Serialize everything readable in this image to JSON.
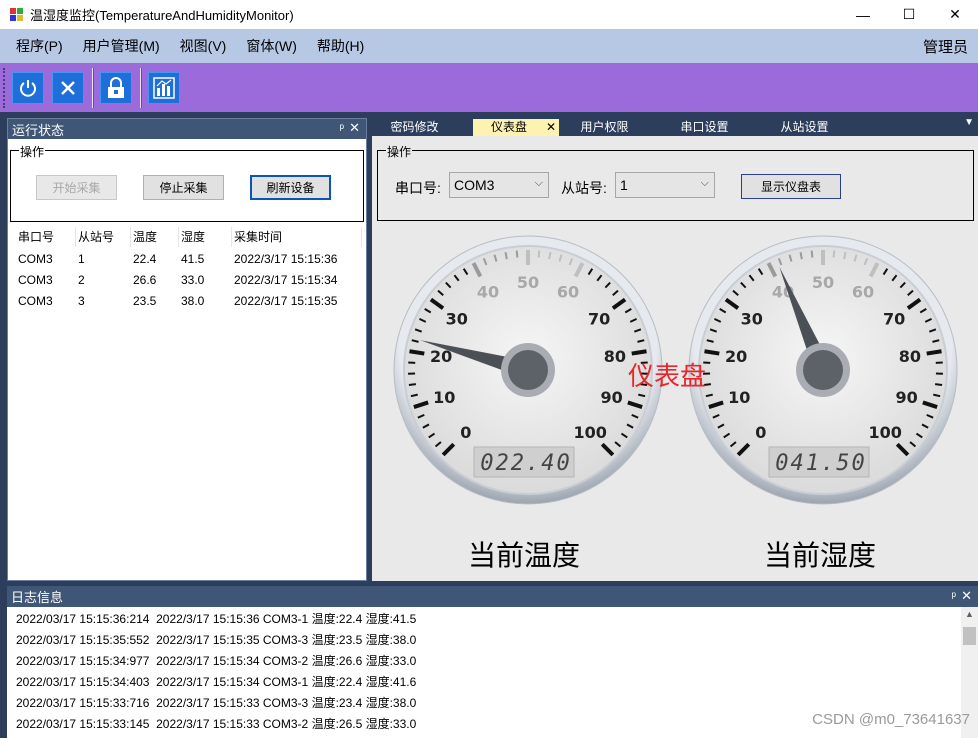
{
  "window": {
    "title": "温湿度监控(TemperatureAndHumidityMonitor)",
    "minimize": "—",
    "maximize": "☐",
    "close": "✕"
  },
  "menu": {
    "items": [
      "程序(P)",
      "用户管理(M)",
      "视图(V)",
      "窗体(W)",
      "帮助(H)"
    ],
    "user": "管理员"
  },
  "toolbar": {
    "icons": [
      "power-icon",
      "close-icon",
      "lock-icon",
      "chart-icon"
    ]
  },
  "left_panel": {
    "title": "运行状态",
    "pin": "ᵖ",
    "close": "✕",
    "group_label": "操作",
    "btn_start": "开始采集",
    "btn_stop": "停止采集",
    "btn_refresh": "刷新设备",
    "columns": [
      "串口号",
      "从站号",
      "温度",
      "湿度",
      "采集时间"
    ],
    "rows": [
      [
        "COM3",
        "1",
        "22.4",
        "41.5",
        "2022/3/17 15:15:36"
      ],
      [
        "COM3",
        "2",
        "26.6",
        "33.0",
        "2022/3/17 15:15:34"
      ],
      [
        "COM3",
        "3",
        "23.5",
        "38.0",
        "2022/3/17 15:15:35"
      ]
    ]
  },
  "right_panel": {
    "tabs": [
      "密码修改",
      "仪表盘",
      "用户权限",
      "串口设置",
      "从站设置"
    ],
    "active_tab": "仪表盘",
    "tab_close": "✕",
    "tab_menu": "▼",
    "group_label": "操作",
    "port_label": "串口号:",
    "port_value": "COM3",
    "slave_label": "从站号:",
    "slave_value": "1",
    "btn_show": "显示仪盘表",
    "overlay": "仪表盘",
    "gauges": [
      {
        "title": "当前温度",
        "display": "022.40",
        "value": 22.4
      },
      {
        "title": "当前湿度",
        "display": "041.50",
        "value": 41.5
      }
    ],
    "gauge_ticks": [
      "0",
      "10",
      "20",
      "30",
      "40",
      "50",
      "60",
      "70",
      "80",
      "90",
      "100"
    ]
  },
  "log_panel": {
    "title": "日志信息",
    "pin": "ᵖ",
    "close": "✕",
    "lines": [
      "2022/03/17 15:15:36:214  2022/3/17 15:15:36 COM3-1 温度:22.4 湿度:41.5",
      "2022/03/17 15:15:35:552  2022/3/17 15:15:35 COM3-3 温度:23.5 湿度:38.0",
      "2022/03/17 15:15:34:977  2022/3/17 15:15:34 COM3-2 温度:26.6 湿度:33.0",
      "2022/03/17 15:15:34:403  2022/3/17 15:15:34 COM3-1 温度:22.4 湿度:41.6",
      "2022/03/17 15:15:33:716  2022/3/17 15:15:33 COM3-3 温度:23.4 湿度:38.0",
      "2022/03/17 15:15:33:145  2022/3/17 15:15:33 COM3-2 温度:26.5 湿度:33.0"
    ]
  },
  "watermark": "CSDN @m0_73641637"
}
